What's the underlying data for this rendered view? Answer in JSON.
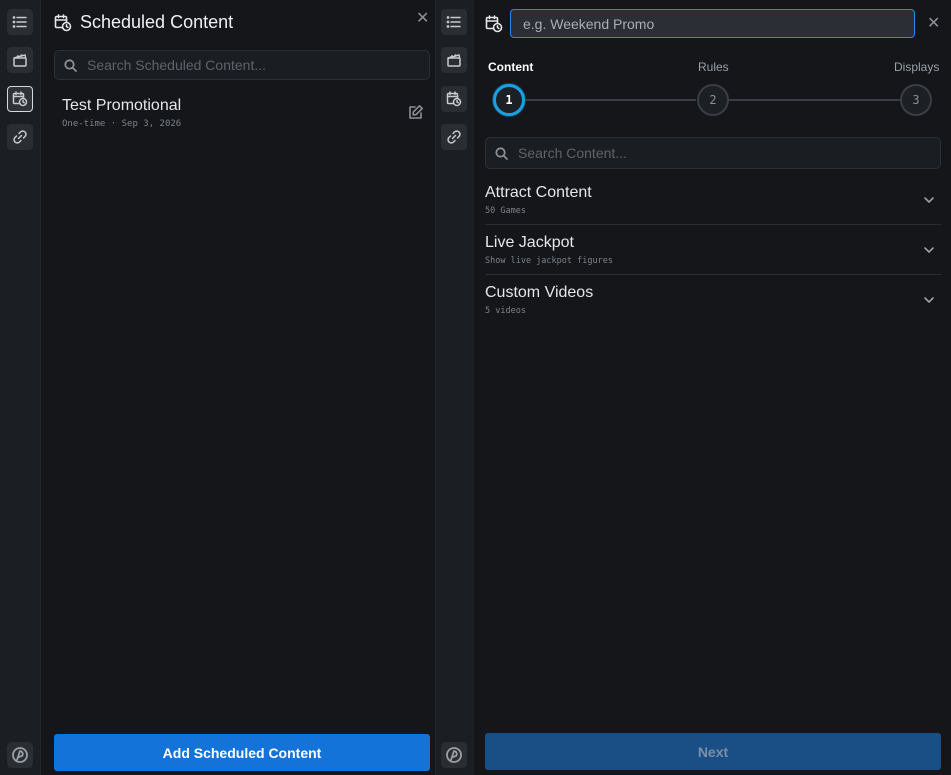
{
  "left_panel": {
    "title": "Scheduled Content",
    "close_label": "✕",
    "search_placeholder": "Search Scheduled Content...",
    "items": [
      {
        "name": "Test Promotional",
        "meta": "One-time · Sep 3, 2026"
      }
    ],
    "add_button_label": "Add Scheduled Content"
  },
  "right_panel": {
    "name_placeholder": "e.g. Weekend Promo",
    "close_label": "✕",
    "steps": [
      {
        "label": "Content",
        "number": "1",
        "active": true
      },
      {
        "label": "Rules",
        "number": "2",
        "active": false
      },
      {
        "label": "Displays",
        "number": "3",
        "active": false
      }
    ],
    "search_placeholder": "Search Content...",
    "sections": [
      {
        "title": "Attract Content",
        "subtitle": "50 Games"
      },
      {
        "title": "Live Jackpot",
        "subtitle": "Show live jackpot figures"
      },
      {
        "title": "Custom Videos",
        "subtitle": "5 videos"
      }
    ],
    "next_label": "Next"
  },
  "rail": {
    "icons": [
      "list-icon",
      "clapperboard-icon",
      "calendar-clock-icon",
      "link-icon",
      "app-logo-icon"
    ],
    "active_left": "calendar-clock-icon"
  },
  "colors": {
    "primary": "#1473d8",
    "next_disabled": "#1a4f85",
    "step_active": "#1f9fe0",
    "input_focus": "#2f86e6",
    "background": "#141619"
  }
}
